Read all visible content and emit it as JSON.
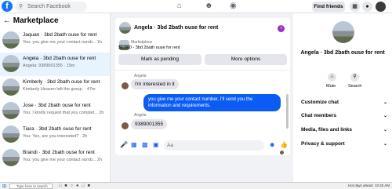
{
  "topbar": {
    "logo": "f",
    "search_placeholder": "Search Facebook",
    "find_friends": "Find friends"
  },
  "sidebar": {
    "title": "Marketplace",
    "conversations": [
      {
        "name": "Jaquan · 3bd 2bath ouse for rent",
        "preview": "You: you give me your contact numb... 1h",
        "active": false
      },
      {
        "name": "Angela · 3bd 2bath ouse for rent",
        "preview": "Angela: 9389001355 · 15m",
        "active": true
      },
      {
        "name": "Kimberly · 3bd 2bath ouse for rent",
        "preview": "Kimberly Heaven left the group. · 47m",
        "active": false
      },
      {
        "name": "Jose · 3bd 2bath ouse for rent",
        "preview": "You: I kindly request that you complet... 2h",
        "active": false
      },
      {
        "name": "Tiara · 3bd 2bath ouse for rent",
        "preview": "You: Yes, are you interested? · 2h",
        "active": false
      },
      {
        "name": "Brandi · 3bd 2bath ouse for rent",
        "preview": "You: you give me your contact numb... 2h",
        "active": false
      }
    ]
  },
  "chat": {
    "title": "Angela · 3bd 2bath ouse for rent",
    "marketplace_label": "Marketplace",
    "listing": "$1,300 - 3bd 2bath ouse for rent",
    "mark_pending": "Mark as pending",
    "more_options": "More options",
    "messages": [
      {
        "sender": "Angela",
        "text": "I'm interested in it",
        "from_me": false
      },
      {
        "sender": "",
        "text": "you give me your contact number, I'll send you the information and requirements.",
        "from_me": true
      },
      {
        "sender": "Angela",
        "text": "9389001355",
        "from_me": false
      }
    ],
    "input_placeholder": "Aa"
  },
  "details": {
    "name": "Angela · 3bd 2bath ouse for rent",
    "mute": "Mute",
    "search": "Search",
    "sections": [
      "Customize chat",
      "Chat members",
      "Media, files and links",
      "Privacy & support"
    ]
  },
  "taskbar": {
    "search_placeholder": "Type here to search",
    "status": "Hot days ahead",
    "time": "10:40 AM"
  },
  "colors": {
    "accent": "#0a5cf5",
    "brand": "#1877f2",
    "active_row": "#e7f3ff",
    "info": "#9b2fc6"
  }
}
